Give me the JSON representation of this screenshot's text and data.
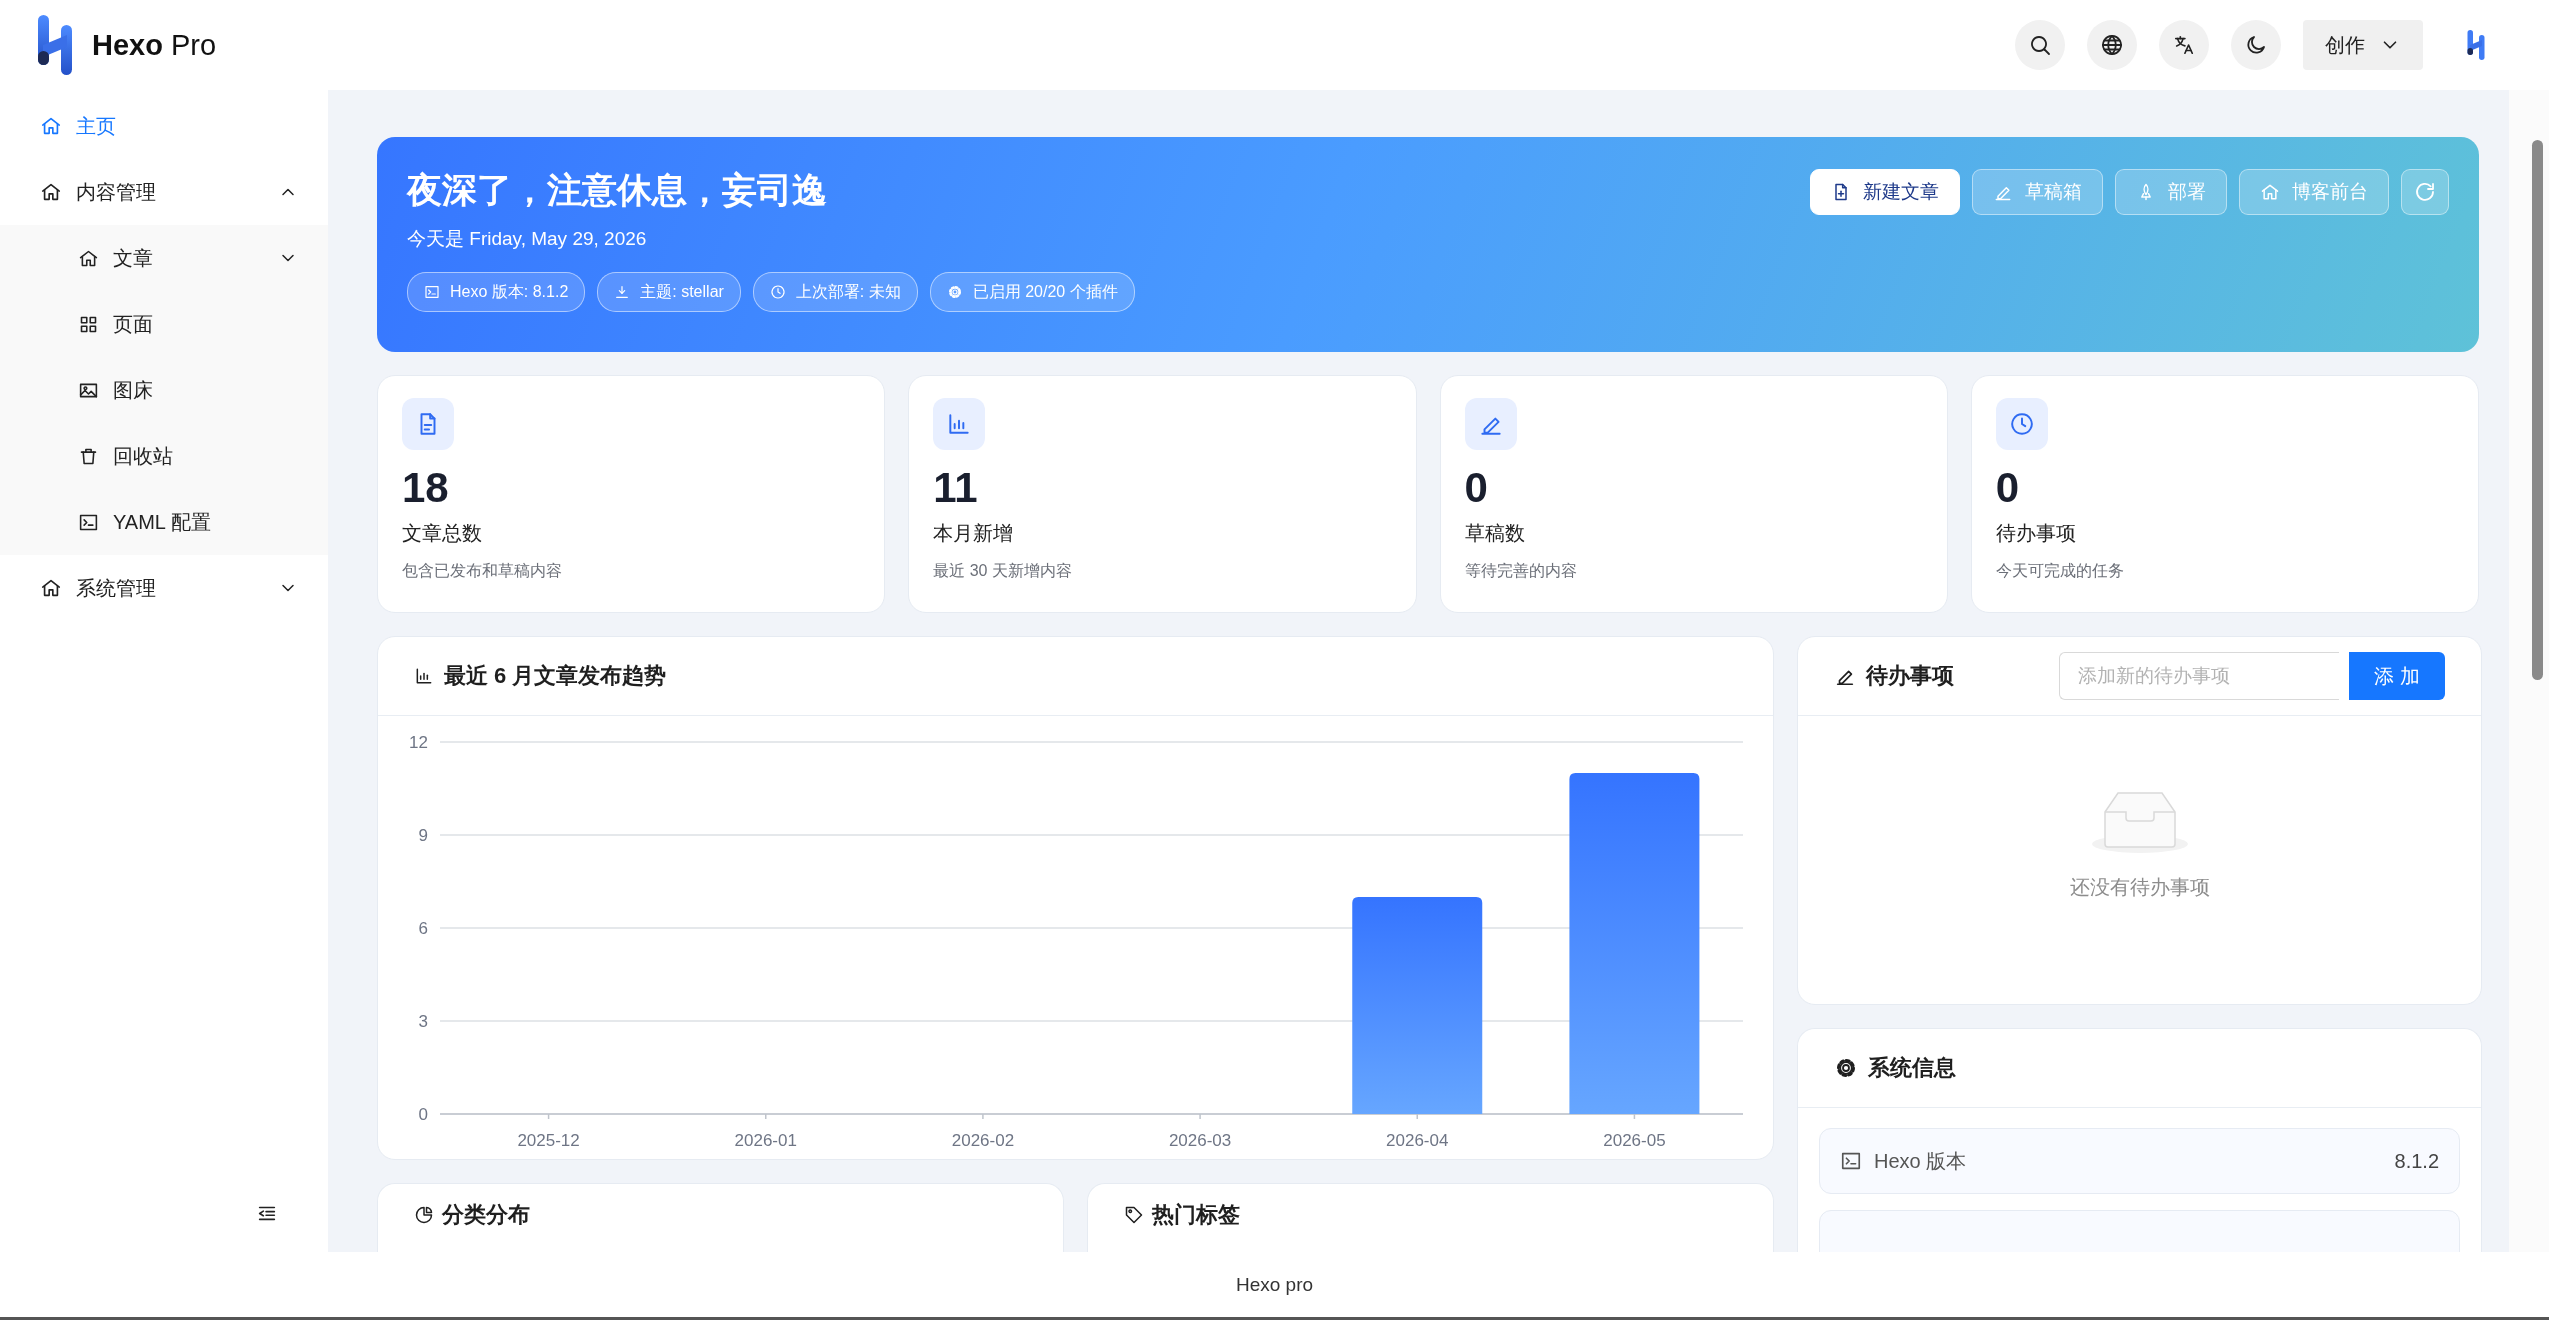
{
  "header": {
    "brand": "Hexo",
    "brand_suffix": "Pro",
    "create_menu": "创作"
  },
  "sidebar": {
    "items": [
      {
        "label": "主页",
        "selected": true
      },
      {
        "label": "内容管理",
        "selected": false,
        "expanded": true,
        "children": [
          {
            "label": "文章",
            "selected": false,
            "expanded": false
          },
          {
            "label": "页面",
            "selected": false
          },
          {
            "label": "图床",
            "selected": false
          },
          {
            "label": "回收站",
            "selected": false
          },
          {
            "label": "YAML 配置",
            "selected": false
          }
        ]
      },
      {
        "label": "系统管理",
        "selected": false,
        "expanded": false
      }
    ]
  },
  "banner": {
    "title": "夜深了，注意休息，妄司逸",
    "date_line": "今天是 Friday, May 29, 2026",
    "pills": [
      "Hexo 版本: 8.1.2",
      "主题: stellar",
      "上次部署: 未知",
      "已启用 20/20 个插件"
    ],
    "buttons": [
      {
        "label": "新建文章",
        "primary": true
      },
      {
        "label": "草稿箱",
        "primary": false
      },
      {
        "label": "部署",
        "primary": false
      },
      {
        "label": "博客前台",
        "primary": false
      }
    ]
  },
  "stats": [
    {
      "value": "18",
      "label": "文章总数",
      "note": "包含已发布和草稿内容"
    },
    {
      "value": "11",
      "label": "本月新增",
      "note": "最近 30 天新增内容"
    },
    {
      "value": "0",
      "label": "草稿数",
      "note": "等待完善的内容"
    },
    {
      "value": "0",
      "label": "待办事项",
      "note": "今天可完成的任务"
    }
  ],
  "trend": {
    "title": "最近 6 月文章发布趋势",
    "chart_data": {
      "type": "bar",
      "categories": [
        "2025-12",
        "2026-01",
        "2026-02",
        "2026-03",
        "2026-04",
        "2026-05"
      ],
      "values": [
        0,
        0,
        0,
        0,
        7,
        11
      ],
      "ylim": [
        0,
        12
      ],
      "grid": true,
      "yticks": [
        0,
        3,
        6,
        9,
        12
      ]
    }
  },
  "todo": {
    "title": "待办事项",
    "placeholder": "添加新的待办事项",
    "add_button": "添 加",
    "empty_text": "还没有待办事项"
  },
  "system_info": {
    "title": "系统信息",
    "rows": [
      {
        "label": "Hexo 版本",
        "value": "8.1.2"
      }
    ]
  },
  "bottom_cards": [
    {
      "title": "分类分布"
    },
    {
      "title": "热门标签"
    }
  ],
  "footer": "Hexo pro"
}
